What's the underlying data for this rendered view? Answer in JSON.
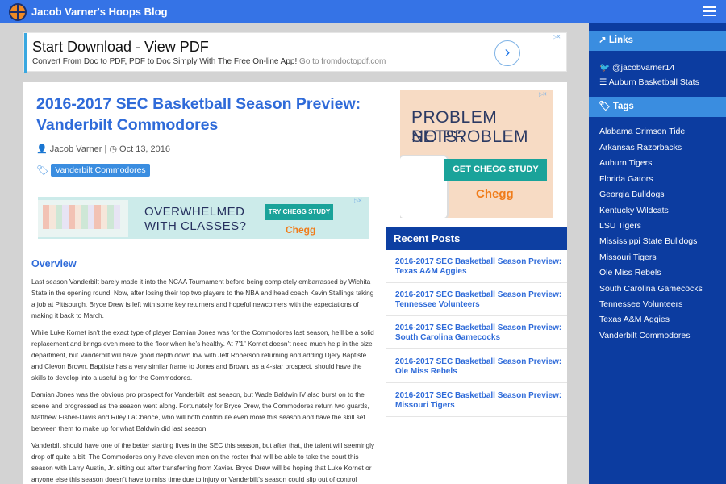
{
  "header": {
    "site_title": "Jacob Varner's Hoops Blog"
  },
  "ad_top": {
    "headline": "Start Download - View PDF",
    "desc": "Convert From Doc to PDF, PDF to Doc Simply With The Free On-line App!",
    "domain": "Go to fromdoctopdf.com"
  },
  "post": {
    "title": "2016-2017 SEC Basketball Season Preview: Vanderbilt Commodores",
    "author": "Jacob Varner",
    "separator": "|",
    "date": "Oct 13, 2016",
    "tag": "Vanderbilt Commodores",
    "section_heading": "Overview",
    "paragraphs": [
      "Last season Vanderbilt barely made it into the NCAA Tournament before being completely embarrassed by Wichita State in the opening round. Now, after losing their top two players to the NBA and head coach Kevin Stallings taking a job at Pittsburgh, Bryce Drew is left with some key returners and hopeful newcomers with the expectations of making it back to March.",
      "While Luke Kornet isn’t the exact type of player Damian Jones was for the Commodores last season, he’ll be a solid replacement and brings even more to the floor when he’s healthy. At 7’1” Kornet doesn’t need much help in the size department, but Vanderbilt will have good depth down low with Jeff Roberson returning and adding Djery Baptiste and Clevon Brown. Baptiste has a very similar frame to Jones and Brown, as a 4-star prospect, should have the skills to develop into a useful big for the Commodores.",
      "Damian Jones was the obvious pro prospect for Vanderbilt last season, but Wade Baldwin IV also burst on to the scene and progressed as the season went along. Fortunately for Bryce Drew, the Commodores return two guards, Matthew Fisher-Davis and Riley LaChance, who will both contribute even more this season and have the skill set between them to make up for what Baldwin did last season.",
      "Vanderbilt should have one of the better starting fives in the SEC this season, but after that, the talent will seemingly drop off quite a bit. The Commodores only have eleven men on the roster that will be able to take the court this season with Larry Austin, Jr. sitting out after transferring from Xavier. Bryce Drew will be hoping that Luke Kornet or anyone else this season doesn’t have to miss time due to injury or Vanderbilt’s season could slip out of control quickly."
    ]
  },
  "banner_ad": {
    "line1": "OVERWHELMED",
    "line2": "WITH CLASSES?",
    "cta": "TRY CHEGG STUDY",
    "brand": "Chegg"
  },
  "side_ad": {
    "line1": "PROBLEM SETS?",
    "line2": "NO PROBLEM",
    "cta": "GET CHEGG STUDY",
    "brand": "Chegg"
  },
  "recent_posts": {
    "heading": "Recent Posts",
    "items": [
      "2016-2017 SEC Basketball Season Preview: Texas A&M Aggies",
      "2016-2017 SEC Basketball Season Preview: Tennessee Volunteers",
      "2016-2017 SEC Basketball Season Preview: South Carolina Gamecocks",
      "2016-2017 SEC Basketball Season Preview: Ole Miss Rebels",
      "2016-2017 SEC Basketball Season Preview: Missouri Tigers"
    ]
  },
  "sidebar": {
    "links_heading": "Links",
    "links": [
      "@jacobvarner14",
      "Auburn Basketball Stats"
    ],
    "tags_heading": "Tags",
    "tags": [
      "Alabama Crimson Tide",
      "Arkansas Razorbacks",
      "Auburn Tigers",
      "Florida Gators",
      "Georgia Bulldogs",
      "Kentucky Wildcats",
      "LSU Tigers",
      "Mississippi State Bulldogs",
      "Missouri Tigers",
      "Ole Miss Rebels",
      "South Carolina Gamecocks",
      "Tennessee Volunteers",
      "Texas A&M Aggies",
      "Vanderbilt Commodores"
    ]
  },
  "icons": {
    "author": "user-icon",
    "date": "clock-icon",
    "tag": "tag-icon",
    "links": "external-link-icon",
    "twitter": "twitter-icon",
    "stats": "list-icon",
    "menu": "hamburger-menu-icon",
    "ad_next": "chevron-right-icon"
  },
  "colors": {
    "topbar": "#3573e6",
    "sidebar": "#0c3ca0",
    "sidebar_header": "#3a8de0",
    "recent_header": "#0d3fa2",
    "link": "#2f6bd9",
    "chegg_teal": "#1aa39a",
    "chegg_orange": "#f07c1a"
  }
}
